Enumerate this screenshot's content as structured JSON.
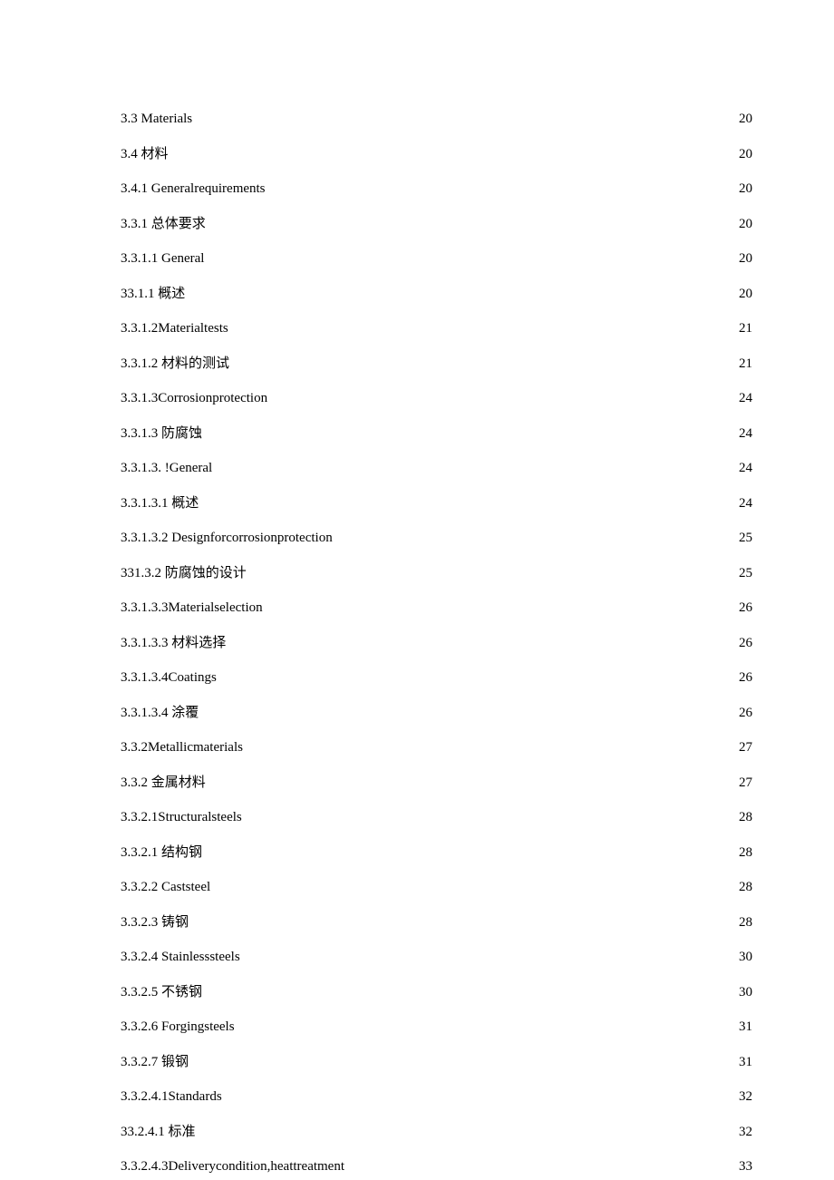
{
  "toc": [
    {
      "label": "3.3   Materials",
      "page": "20",
      "sparse": false
    },
    {
      "label": "3.4   材料",
      "page": "20",
      "sparse": true
    },
    {
      "label": "3.4.1   Generalrequirements",
      "page": "20",
      "sparse": false
    },
    {
      "label": "3.3.1     总体要求",
      "page": "20",
      "sparse": true
    },
    {
      "label": "3.3.1.1   General ",
      "page": "20",
      "sparse": false
    },
    {
      "label": "33.1.1 概述",
      "page": "20",
      "sparse": true
    },
    {
      "label": "3.3.1.2Materialtests ",
      "page": "21",
      "sparse": false
    },
    {
      "label": "3.3.1.2 材料的测试",
      "page": "21",
      "sparse": true
    },
    {
      "label": "3.3.1.3Corrosionprotection",
      "page": "24",
      "sparse": false
    },
    {
      "label": "3.3.1.3 防腐蚀",
      "page": "24",
      "sparse": true
    },
    {
      "label": "3.3.1.3.  !General ",
      "page": "24",
      "sparse": false
    },
    {
      "label": "3.3.1.3.1   概述",
      "page": "24",
      "sparse": true
    },
    {
      "label": "3.3.1.3.2   Designforcorrosionprotection ",
      "page": "25",
      "sparse": false
    },
    {
      "label": "331.3.2 防腐蚀的设计",
      "page": "25",
      "sparse": true
    },
    {
      "label": "3.3.1.3.3Materialselection ",
      "page": "26",
      "sparse": false
    },
    {
      "label": "3.3.1.3.3 材料选择",
      "page": "26",
      "sparse": true
    },
    {
      "label": "3.3.1.3.4Coatings",
      "page": "26",
      "sparse": false
    },
    {
      "label": "3.3.1.3.4 涂覆",
      "page": "26",
      "sparse": true
    },
    {
      "label": "3.3.2Metallicmaterials ",
      "page": "27",
      "sparse": false
    },
    {
      "label": "3.3.2 金属材料",
      "page": "27",
      "sparse": true
    },
    {
      "label": "3.3.2.1Structuralsteels ",
      "page": "28",
      "sparse": false
    },
    {
      "label": "3.3.2.1   结构钢",
      "page": "28",
      "sparse": true
    },
    {
      "label": "3.3.2.2   Caststeel ",
      "page": "28",
      "sparse": false
    },
    {
      "label": "3.3.2.3   铸钢",
      "page": "28",
      "sparse": true
    },
    {
      "label": "3.3.2.4   Stainlesssteels",
      "page": "30",
      "sparse": false
    },
    {
      "label": "3.3.2.5   不锈钢",
      "page": "30",
      "sparse": true
    },
    {
      "label": "3.3.2.6   Forgingsteels ",
      "page": "31",
      "sparse": false
    },
    {
      "label": "3.3.2.7   锻钢",
      "page": "31",
      "sparse": true
    },
    {
      "label": "3.3.2.4.1Standards ",
      "page": "32",
      "sparse": false
    },
    {
      "label": "33.2.4.1 标准",
      "page": "32",
      "sparse": true
    },
    {
      "label": "3.3.2.4.3Deliverycondition,heattreatment ",
      "page": "33",
      "sparse": false
    }
  ]
}
